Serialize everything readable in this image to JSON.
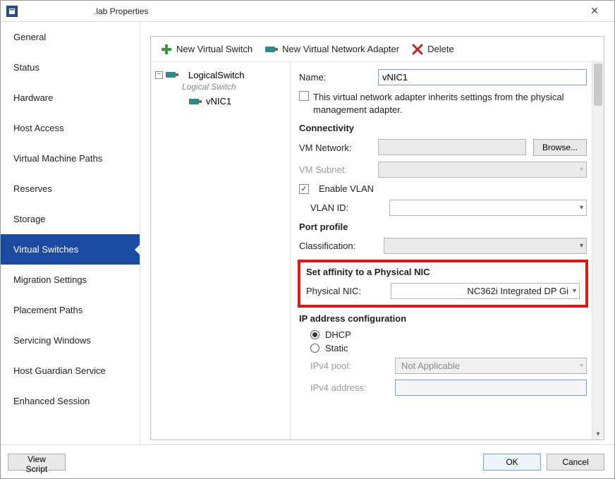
{
  "window": {
    "title": ".lab Properties"
  },
  "sidebar": {
    "items": [
      "General",
      "Status",
      "Hardware",
      "Host Access",
      "Virtual Machine Paths",
      "Reserves",
      "Storage",
      "Virtual Switches",
      "Migration Settings",
      "Placement Paths",
      "Servicing Windows",
      "Host Guardian Service",
      "Enhanced Session"
    ],
    "selected_index": 7
  },
  "toolbar": {
    "new_switch": "New Virtual Switch",
    "new_adapter": "New Virtual Network Adapter",
    "delete": "Delete"
  },
  "tree": {
    "switch_name": "LogicalSwitch",
    "switch_subtitle": "Logical Switch",
    "child_adapter": "vNIC1"
  },
  "form": {
    "name_label": "Name:",
    "name_value": "vNIC1",
    "inherit_label": "This virtual network adapter inherits settings from the physical management adapter.",
    "connectivity_heading": "Connectivity",
    "vm_network_label": "VM Network:",
    "browse_btn": "Browse...",
    "vm_subnet_label": "VM Subnet:",
    "enable_vlan_label": "Enable VLAN",
    "vlan_id_label": "VLAN ID:",
    "port_profile_heading": "Port profile",
    "classification_label": "Classification:",
    "affinity_heading": "Set affinity to a Physical NIC",
    "physical_nic_label": "Physical NIC:",
    "physical_nic_value": "NC362i Integrated DP Gi",
    "ipconfig_heading": "IP address configuration",
    "dhcp_label": "DHCP",
    "static_label": "Static",
    "ipv4_pool_label": "IPv4 pool:",
    "ipv4_pool_value": "Not Applicable",
    "ipv4_addr_label": "IPv4 address:"
  },
  "footer": {
    "view_script": "View Script",
    "ok": "OK",
    "cancel": "Cancel"
  }
}
